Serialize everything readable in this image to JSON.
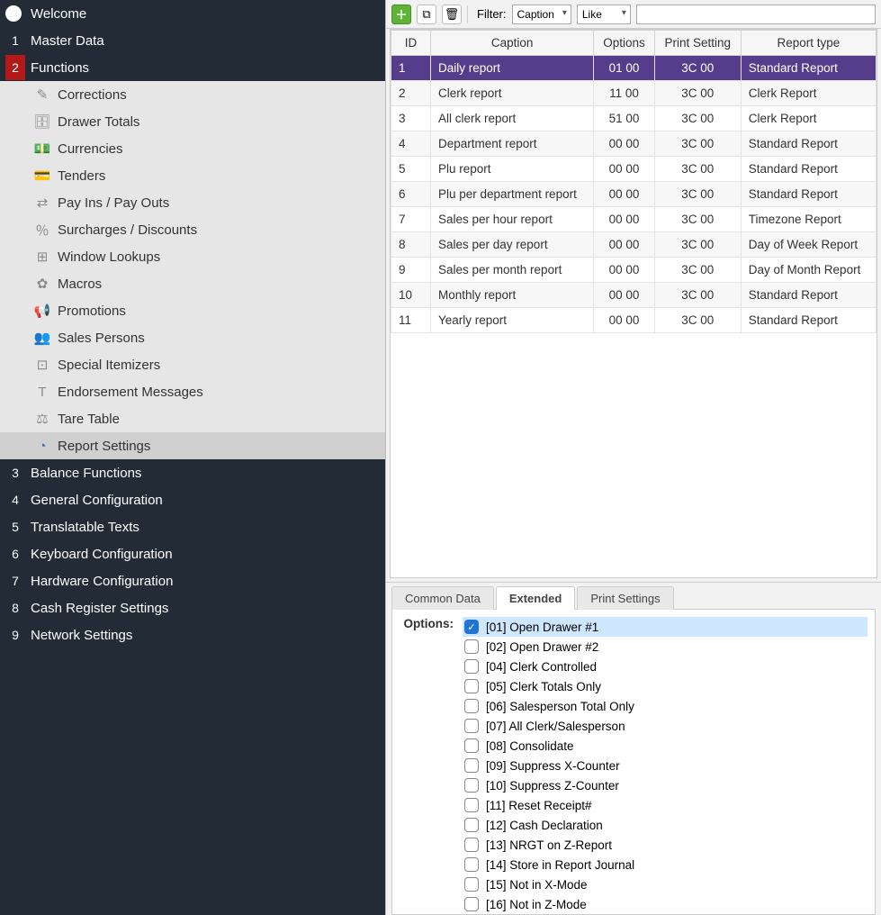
{
  "sidebar": {
    "welcome": "Welcome",
    "items": [
      {
        "num": "1",
        "label": "Master Data"
      },
      {
        "num": "2",
        "label": "Functions",
        "active": true
      },
      {
        "num": "3",
        "label": "Balance Functions"
      },
      {
        "num": "4",
        "label": "General Configuration"
      },
      {
        "num": "5",
        "label": "Translatable Texts"
      },
      {
        "num": "6",
        "label": "Keyboard Configuration"
      },
      {
        "num": "7",
        "label": "Hardware Configuration"
      },
      {
        "num": "8",
        "label": "Cash Register Settings"
      },
      {
        "num": "9",
        "label": "Network Settings"
      }
    ],
    "sub": [
      {
        "icon": "edit-icon",
        "label": "Corrections"
      },
      {
        "icon": "drawer-icon",
        "label": "Drawer Totals"
      },
      {
        "icon": "money-icon",
        "label": "Currencies"
      },
      {
        "icon": "card-icon",
        "label": "Tenders"
      },
      {
        "icon": "payinout-icon",
        "label": "Pay Ins / Pay Outs"
      },
      {
        "icon": "percent-icon",
        "label": "Surcharges / Discounts"
      },
      {
        "icon": "window-icon",
        "label": "Window Lookups"
      },
      {
        "icon": "macro-icon",
        "label": "Macros"
      },
      {
        "icon": "promo-icon",
        "label": "Promotions"
      },
      {
        "icon": "people-icon",
        "label": "Sales Persons"
      },
      {
        "icon": "itemizer-icon",
        "label": "Special Itemizers"
      },
      {
        "icon": "endorse-icon",
        "label": "Endorsement Messages"
      },
      {
        "icon": "tare-icon",
        "label": "Tare Table"
      },
      {
        "icon": "report-icon",
        "label": "Report Settings",
        "active": true
      }
    ]
  },
  "toolbar": {
    "filter_label": "Filter:",
    "combo1": "Caption",
    "combo2": "Like",
    "search_value": ""
  },
  "grid": {
    "headers": [
      "ID",
      "Caption",
      "Options",
      "Print Setting",
      "Report type"
    ],
    "rows": [
      {
        "id": "1",
        "caption": "Daily report",
        "options": "01 00",
        "print": "3C 00",
        "type": "Standard Report",
        "selected": true
      },
      {
        "id": "2",
        "caption": "Clerk report",
        "options": "11 00",
        "print": "3C 00",
        "type": "Clerk Report"
      },
      {
        "id": "3",
        "caption": "All clerk report",
        "options": "51 00",
        "print": "3C 00",
        "type": "Clerk Report"
      },
      {
        "id": "4",
        "caption": "Department report",
        "options": "00 00",
        "print": "3C 00",
        "type": "Standard Report"
      },
      {
        "id": "5",
        "caption": "Plu report",
        "options": "00 00",
        "print": "3C 00",
        "type": "Standard Report"
      },
      {
        "id": "6",
        "caption": "Plu per department report",
        "options": "00 00",
        "print": "3C 00",
        "type": "Standard Report"
      },
      {
        "id": "7",
        "caption": "Sales per hour report",
        "options": "00 00",
        "print": "3C 00",
        "type": "Timezone Report"
      },
      {
        "id": "8",
        "caption": "Sales per day report",
        "options": "00 00",
        "print": "3C 00",
        "type": "Day of Week Report"
      },
      {
        "id": "9",
        "caption": "Sales per month report",
        "options": "00 00",
        "print": "3C 00",
        "type": "Day of Month Report"
      },
      {
        "id": "10",
        "caption": "Monthly report",
        "options": "00 00",
        "print": "3C 00",
        "type": "Standard Report"
      },
      {
        "id": "11",
        "caption": "Yearly report",
        "options": "00 00",
        "print": "3C 00",
        "type": "Standard Report"
      }
    ]
  },
  "tabs": {
    "items": [
      "Common Data",
      "Extended",
      "Print Settings"
    ],
    "active": 1,
    "options_label": "Options:"
  },
  "options": [
    {
      "label": "[01] Open Drawer #1",
      "checked": true,
      "selected": true
    },
    {
      "label": "[02] Open Drawer #2"
    },
    {
      "label": "[04] Clerk Controlled"
    },
    {
      "label": "[05] Clerk Totals Only"
    },
    {
      "label": "[06] Salesperson Total Only"
    },
    {
      "label": "[07] All Clerk/Salesperson"
    },
    {
      "label": "[08] Consolidate"
    },
    {
      "label": "[09] Suppress X-Counter"
    },
    {
      "label": "[10] Suppress Z-Counter"
    },
    {
      "label": "[11] Reset Receipt#"
    },
    {
      "label": "[12] Cash Declaration"
    },
    {
      "label": "[13] NRGT on Z-Report"
    },
    {
      "label": "[14] Store in Report Journal"
    },
    {
      "label": "[15] Not in X-Mode"
    },
    {
      "label": "[16] Not in Z-Mode"
    }
  ]
}
